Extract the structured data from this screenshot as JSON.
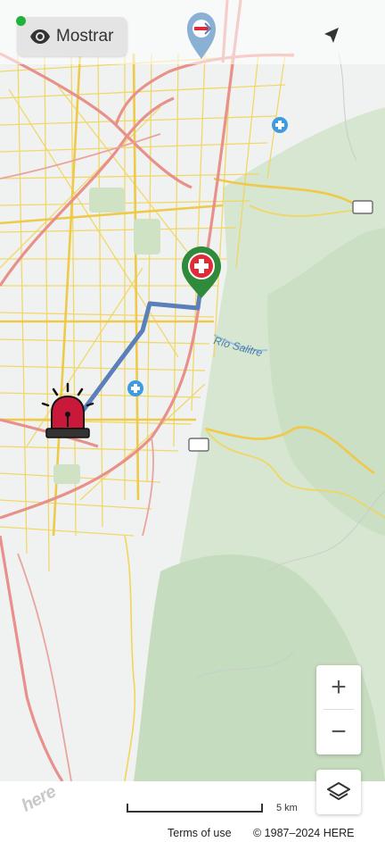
{
  "header": {
    "show_label": "Mostrar",
    "status_color": "#1fb33a"
  },
  "map": {
    "place_label": "Río Salitre",
    "route_color": "#5b7fba",
    "destination_marker": "hospital-pin-icon",
    "origin_marker": "emergency-siren-icon"
  },
  "controls": {
    "zoom_in": "+",
    "zoom_out": "−"
  },
  "footer": {
    "scale_label": "5 km",
    "terms_label": "Terms of use",
    "copyright": "© 1987–2024 HERE",
    "logo_text": "here"
  }
}
